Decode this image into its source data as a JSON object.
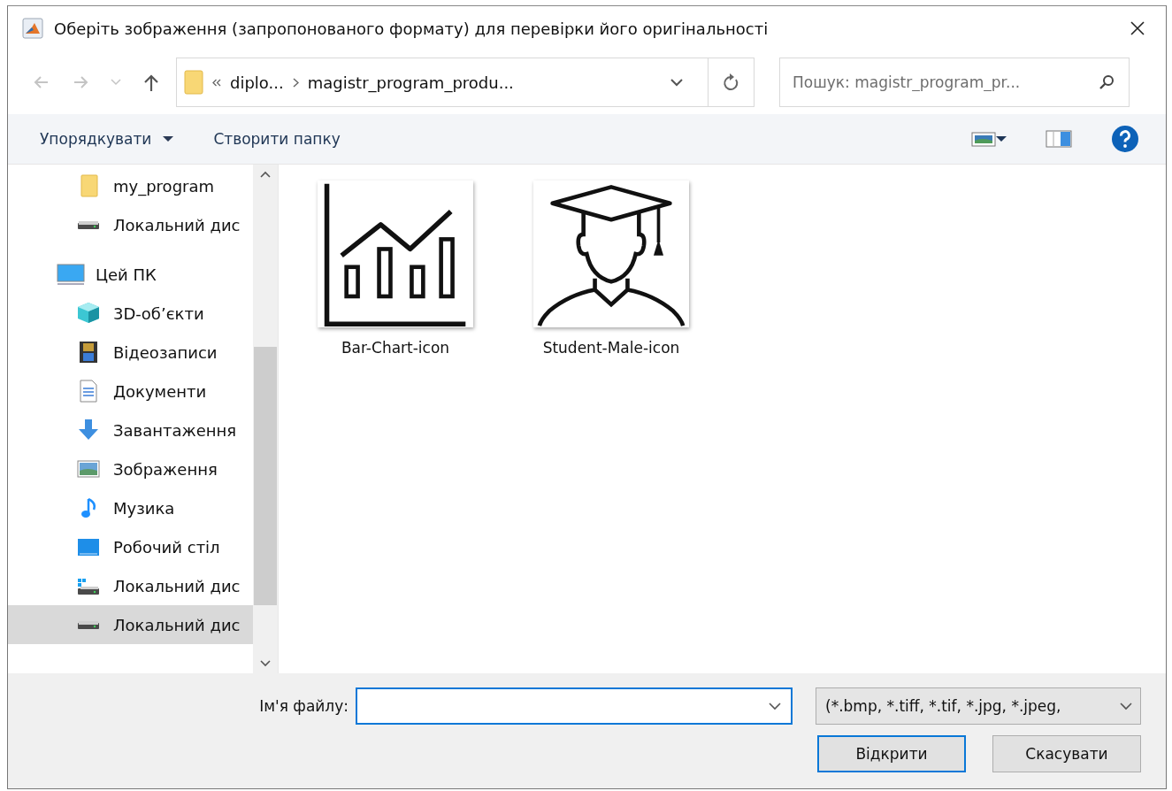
{
  "window": {
    "title": "Оберіть зображення (запропонованого формату) для перевірки його оригінальності"
  },
  "navigation": {
    "breadcrumb": [
      {
        "label": "diplo..."
      },
      {
        "label": "magistr_program_produ..."
      }
    ],
    "search": {
      "placeholder": "Пошук: magistr_program_pr..."
    }
  },
  "toolbar": {
    "organize": "Упорядкувати",
    "new_folder": "Створити папку"
  },
  "sidebar": {
    "items": [
      {
        "children": [
          {
            "label": "my_program",
            "kind": "folder",
            "selected": false
          },
          {
            "label": "Локальний дис",
            "kind": "drive",
            "selected": false
          }
        ]
      },
      {
        "label": "Цей ПК",
        "kind": "pc",
        "selected": false,
        "children": [
          {
            "label": "3D-об’єкти",
            "kind": "cube",
            "selected": false
          },
          {
            "label": "Відеозаписи",
            "kind": "film",
            "selected": false
          },
          {
            "label": "Документи",
            "kind": "document",
            "selected": false
          },
          {
            "label": "Завантаження",
            "kind": "download",
            "selected": false
          },
          {
            "label": "Зображення",
            "kind": "pictures",
            "selected": false
          },
          {
            "label": "Музика",
            "kind": "music",
            "selected": false
          },
          {
            "label": "Робочий стіл",
            "kind": "desktop",
            "selected": false
          },
          {
            "label": "Локальний дис",
            "kind": "windrive",
            "selected": false
          },
          {
            "label": "Локальний дис",
            "kind": "drive",
            "selected": true
          }
        ]
      }
    ]
  },
  "files": [
    {
      "name": "Bar-Chart-icon",
      "kind": "chart"
    },
    {
      "name": "Student-Male-icon",
      "kind": "student"
    }
  ],
  "footer": {
    "filename_label": "Ім'я файлу:",
    "filename_focused": true,
    "filter": "(*.bmp, *.tiff, *.tif, *.jpg, *.jpeg,",
    "buttons": [
      {
        "label": "Відкрити",
        "default": true
      },
      {
        "label": "Скасувати",
        "default": false
      }
    ]
  }
}
